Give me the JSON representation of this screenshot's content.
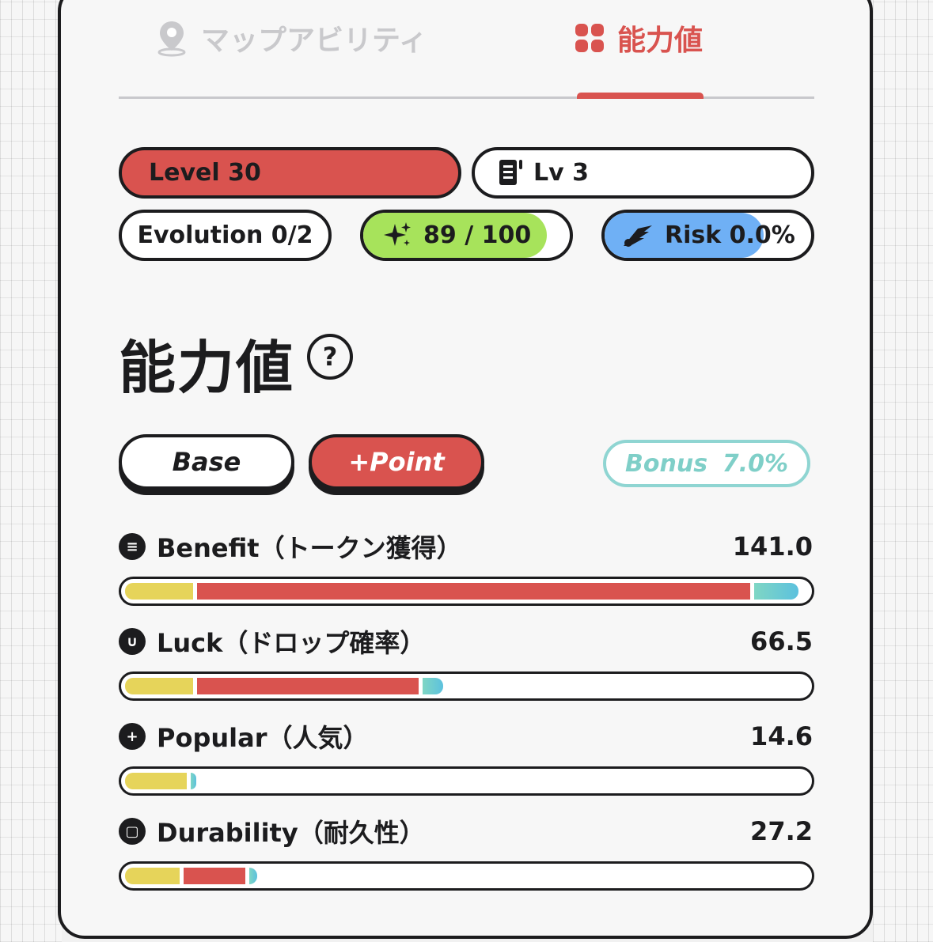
{
  "tabs": {
    "map_ability": "マップアビリティ",
    "stats": "能力値"
  },
  "badges": {
    "level": "Level 30",
    "lv": "Lv 3",
    "evolution": "Evolution 0/2",
    "energy": "89 / 100",
    "energy_fraction": 0.89,
    "risk": "Risk 0.0%",
    "risk_fraction": 0.77
  },
  "section": {
    "title": "能力値",
    "help": "?"
  },
  "modes": {
    "base": "Base",
    "point": "+Point",
    "bonus_label": "Bonus",
    "bonus_value": "7.0%"
  },
  "stats": [
    {
      "label": "Benefit（トークン獲得）",
      "value": "141.0",
      "icon": "list-icon",
      "base": 0.1,
      "point": 0.81,
      "bonus": 0.065
    },
    {
      "label": "Luck（ドロップ確率）",
      "value": "66.5",
      "icon": "horseshoe-icon",
      "base": 0.1,
      "point": 0.325,
      "bonus": 0.03
    },
    {
      "label": "Popular（人気）",
      "value": "14.6",
      "icon": "plus-icon",
      "base": 0.09,
      "point": 0,
      "bonus": 0.008
    },
    {
      "label": "Durability（耐久性）",
      "value": "27.2",
      "icon": "square-icon",
      "base": 0.08,
      "point": 0.09,
      "bonus": 0.012
    }
  ],
  "colors": {
    "accent": "#d9534f",
    "energy": "#a7e35b",
    "risk": "#6fb0f5",
    "base_bar": "#e6d45a",
    "bonus_bar": "#7fd6c4"
  }
}
